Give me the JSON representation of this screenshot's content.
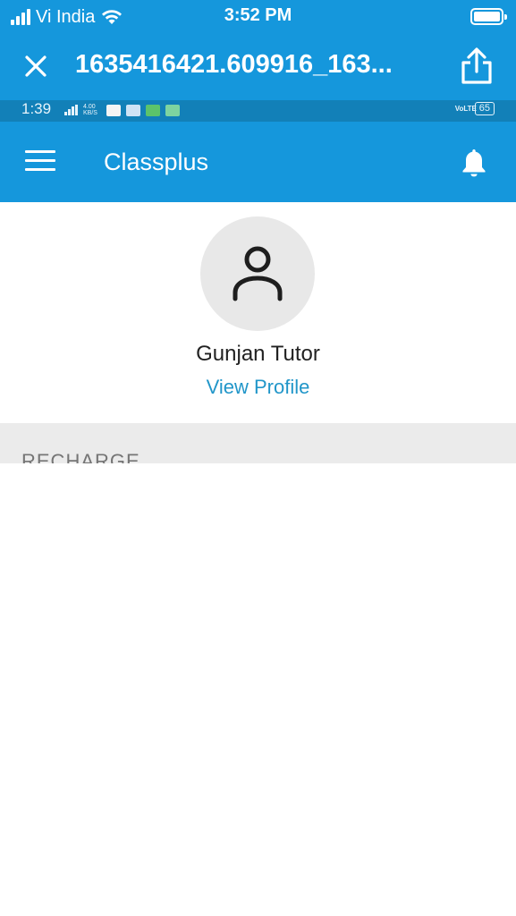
{
  "ios_status": {
    "carrier": "Vi India",
    "time": "3:52 PM"
  },
  "viewer": {
    "file_title": "1635416421.609916_163..."
  },
  "embedded": {
    "android_status": {
      "time": "1:39",
      "speed": "4.00 KB/S",
      "network": "VoLTE",
      "battery": "65"
    },
    "app_bar": {
      "title": "Classplus"
    },
    "profile": {
      "name": "Gunjan Tutor",
      "view_profile": "View Profile"
    },
    "section": {
      "label": "RECHARGE"
    }
  },
  "colors": {
    "primary": "#1597dc",
    "link": "#2196c9"
  }
}
